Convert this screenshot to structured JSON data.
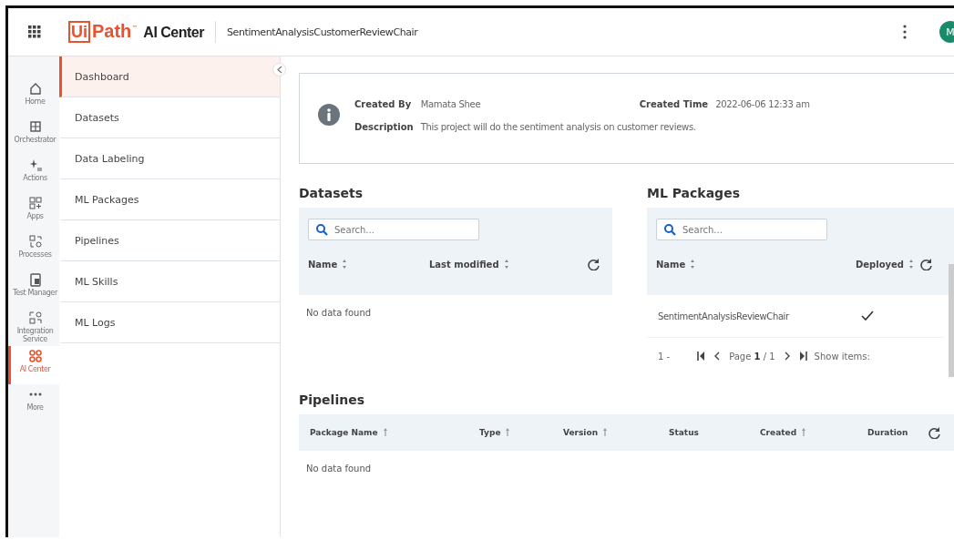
{
  "header": {
    "logo_box": "Ui",
    "logo_text": "Path",
    "logo_tm": "™",
    "product": "AI Center",
    "project": "SentimentAnalysisCustomerReviewChair",
    "avatar": "M"
  },
  "rail": [
    {
      "label": "Home",
      "selected": false
    },
    {
      "label": "Orchestrator",
      "selected": false
    },
    {
      "label": "Actions",
      "selected": false
    },
    {
      "label": "Apps",
      "selected": false
    },
    {
      "label": "Processes",
      "selected": false
    },
    {
      "label": "Test Manager",
      "selected": false
    },
    {
      "label": "Integration Service",
      "selected": false
    },
    {
      "label": "AI Center",
      "selected": true
    },
    {
      "label": "More",
      "selected": false
    }
  ],
  "nav": [
    {
      "label": "Dashboard",
      "selected": true
    },
    {
      "label": "Datasets",
      "selected": false
    },
    {
      "label": "Data Labeling",
      "selected": false
    },
    {
      "label": "ML Packages",
      "selected": false
    },
    {
      "label": "Pipelines",
      "selected": false
    },
    {
      "label": "ML Skills",
      "selected": false
    },
    {
      "label": "ML Logs",
      "selected": false
    }
  ],
  "info": {
    "created_by_label": "Created By",
    "created_by": "Mamata Shee",
    "created_time_label": "Created Time",
    "created_time": "2022-06-06 12:33 am",
    "description_label": "Description",
    "description": "This project will do the sentiment analysis on customer reviews."
  },
  "datasets": {
    "title": "Datasets",
    "search": {
      "placeholder": "Search..."
    },
    "columns": [
      {
        "label": "Name"
      },
      {
        "label": "Last modified"
      }
    ],
    "empty": "No data found"
  },
  "ml_packages": {
    "title": "ML Packages",
    "search": {
      "placeholder": "Search..."
    },
    "columns": [
      {
        "label": "Name"
      },
      {
        "label": "Deployed"
      }
    ],
    "rows": [
      {
        "name": "SentimentAnalysisReviewChair",
        "deployed": true
      }
    ],
    "pager": {
      "range": "1 -",
      "page": "Page **1** / 1",
      "show_items": "Show items:"
    }
  },
  "pipelines": {
    "title": "Pipelines",
    "columns": [
      {
        "label": "Package Name",
        "sortable": true
      },
      {
        "label": "Type",
        "sortable": true
      },
      {
        "label": "Version",
        "sortable": true
      },
      {
        "label": "Status",
        "sortable": false
      },
      {
        "label": "Created",
        "sortable": true
      },
      {
        "label": "Duration",
        "sortable": false
      }
    ],
    "empty": "No data found"
  }
}
